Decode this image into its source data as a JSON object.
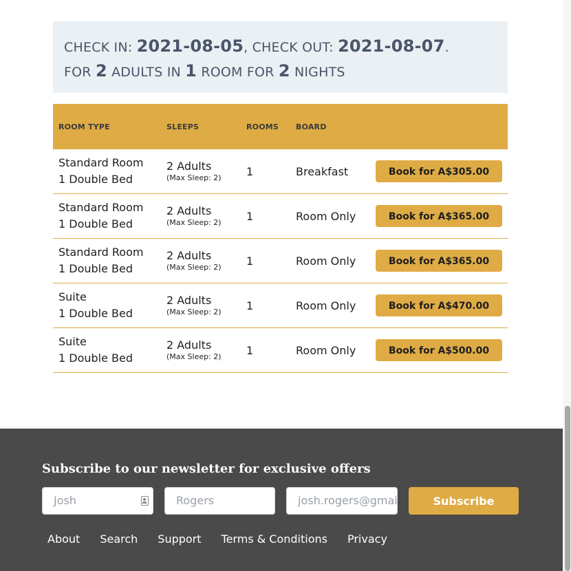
{
  "summary": {
    "check_in_label": "CHECK IN:",
    "check_in": "2021-08-05",
    "sep": ", ",
    "check_out_label": "CHECK OUT:",
    "check_out": "2021-08-07",
    "end": ".",
    "for_label": "FOR",
    "adults": "2",
    "adults_label": "ADULTS IN",
    "rooms": "1",
    "rooms_label": "ROOM FOR",
    "nights": "2",
    "nights_label": "NIGHTS"
  },
  "table": {
    "headers": [
      "ROOM TYPE",
      "SLEEPS",
      "ROOMS",
      "BOARD",
      ""
    ],
    "rows": [
      {
        "type": "Standard Room",
        "bed": "1 Double Bed",
        "sleeps": "2 Adults",
        "max": "(Max Sleep: 2)",
        "rooms": "1",
        "board": "Breakfast",
        "book": "Book for A$305.00"
      },
      {
        "type": "Standard Room",
        "bed": "1 Double Bed",
        "sleeps": "2 Adults",
        "max": "(Max Sleep: 2)",
        "rooms": "1",
        "board": "Room Only",
        "book": "Book for A$365.00"
      },
      {
        "type": "Standard Room",
        "bed": "1 Double Bed",
        "sleeps": "2 Adults",
        "max": "(Max Sleep: 2)",
        "rooms": "1",
        "board": "Room Only",
        "book": "Book for A$365.00"
      },
      {
        "type": "Suite",
        "bed": "1 Double Bed",
        "sleeps": "2 Adults",
        "max": "(Max Sleep: 2)",
        "rooms": "1",
        "board": "Room Only",
        "book": "Book for A$470.00"
      },
      {
        "type": "Suite",
        "bed": "1 Double Bed",
        "sleeps": "2 Adults",
        "max": "(Max Sleep: 2)",
        "rooms": "1",
        "board": "Room Only",
        "book": "Book for A$500.00"
      }
    ]
  },
  "footer": {
    "newsletter_title": "Subscribe to our newsletter for exclusive offers",
    "first_name_placeholder": "Josh",
    "last_name_placeholder": "Rogers",
    "email_placeholder": "josh.rogers@gmail.com",
    "subscribe_label": "Subscribe",
    "links": [
      "About",
      "Search",
      "Support",
      "Terms & Conditions",
      "Privacy"
    ]
  },
  "colors": {
    "accent": "#dfab45",
    "summary_bg": "#ebf0f5",
    "footer_bg": "#4a4a4a"
  }
}
